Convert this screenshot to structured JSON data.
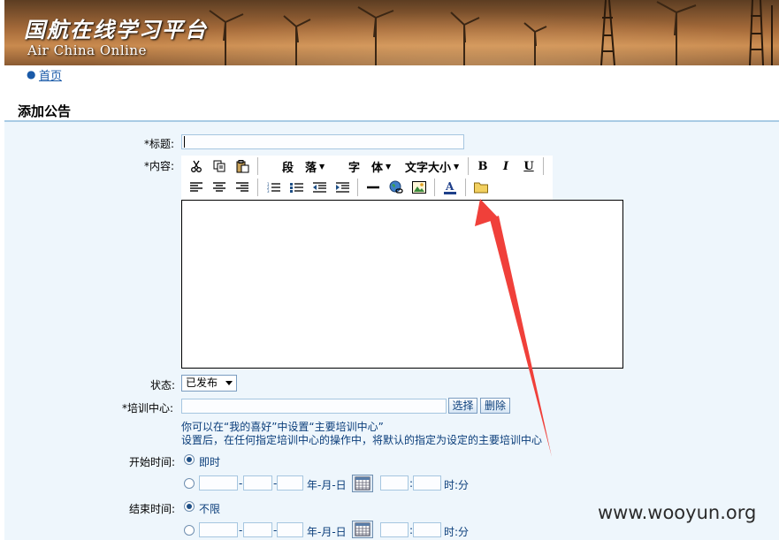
{
  "banner": {
    "title_cn": "国航在线学习平台",
    "title_en": "Air China Online"
  },
  "nav": {
    "home_label": "首页"
  },
  "page": {
    "title": "添加公告"
  },
  "form": {
    "title_label": "*标题:",
    "content_label": "*内容:",
    "status_label": "状态:",
    "status_value": "已发布",
    "center_label": "*培训中心:",
    "center_select_button": "选择",
    "center_delete_button": "删除",
    "center_hint_1": "你可以在“我的喜好”中设置“主要培训中心”",
    "center_hint_2": "设置后，在任何指定培训中心的操作中，将默认的指定为设定的主要培训中心",
    "start_label": "开始时间:",
    "start_immediate_label": "即时",
    "end_label": "结束时间:",
    "end_unlimited_label": "不限",
    "date_format_label": "年-月-日",
    "time_format_label": "时:分",
    "dash": "-",
    "colon": ":"
  },
  "toolbar": {
    "paragraph_label": "段　落",
    "font_label": "字　体",
    "font_size_label": "文字大小",
    "bold_label": "B",
    "italic_label": "I",
    "underline_label": "U"
  },
  "watermark": "www.wooyun.org",
  "colors": {
    "accent_text": "#0a3d7a",
    "link": "#1a5aa8",
    "form_background": "#eef6fc",
    "annotation_arrow": "#f0403a"
  }
}
